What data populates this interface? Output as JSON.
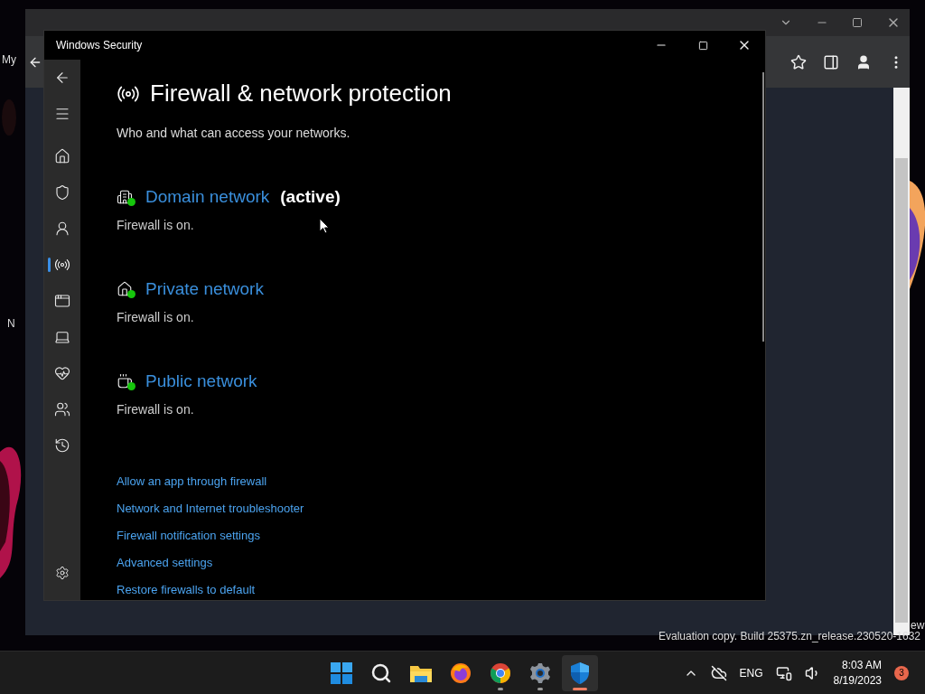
{
  "desktop": {
    "fragments": [
      {
        "kind": "top-left",
        "text": "My"
      },
      {
        "kind": "left",
        "text": "N"
      },
      {
        "kind": "right",
        "text": "ew"
      }
    ]
  },
  "window": {
    "title": "Windows Security"
  },
  "sidebar": {
    "items": [
      {
        "kind": "back",
        "selected": false
      },
      {
        "kind": "menu",
        "selected": false
      },
      {
        "kind": "home",
        "selected": false
      },
      {
        "kind": "shield",
        "selected": false
      },
      {
        "kind": "account",
        "selected": false
      },
      {
        "kind": "firewall",
        "selected": true
      },
      {
        "kind": "app",
        "selected": false
      },
      {
        "kind": "device",
        "selected": false
      },
      {
        "kind": "health",
        "selected": false
      },
      {
        "kind": "family",
        "selected": false
      },
      {
        "kind": "history",
        "selected": false
      },
      {
        "kind": "settings",
        "selected": false
      }
    ]
  },
  "page": {
    "title": "Firewall & network protection",
    "subtitle": "Who and what can access your networks."
  },
  "networks": [
    {
      "kind": "domain",
      "name": "Domain network",
      "badge": "(active)",
      "status": "Firewall is on.",
      "on": true
    },
    {
      "kind": "private",
      "name": "Private network",
      "status": "Firewall is on.",
      "on": true
    },
    {
      "kind": "public",
      "name": "Public network",
      "status": "Firewall is on.",
      "on": true
    }
  ],
  "links": [
    "Allow an app through firewall",
    "Network and Internet troubleshooter",
    "Firewall notification settings",
    "Advanced settings",
    "Restore firewalls to default"
  ],
  "build_notice": "Evaluation copy. Build 25375.zn_release.230520-1632",
  "taskbar": {
    "apps": [
      {
        "kind": "start",
        "running": false,
        "selected": false
      },
      {
        "kind": "search",
        "running": false,
        "selected": false
      },
      {
        "kind": "explorer",
        "running": false,
        "selected": false
      },
      {
        "kind": "firefox",
        "running": false,
        "selected": false
      },
      {
        "kind": "chrome",
        "running": true,
        "selected": false
      },
      {
        "kind": "settings",
        "running": true,
        "selected": false
      },
      {
        "kind": "defender",
        "running": true,
        "selected": true
      }
    ],
    "language": "ENG",
    "time": "8:03 AM",
    "date": "8/19/2023",
    "notifications": "3"
  }
}
